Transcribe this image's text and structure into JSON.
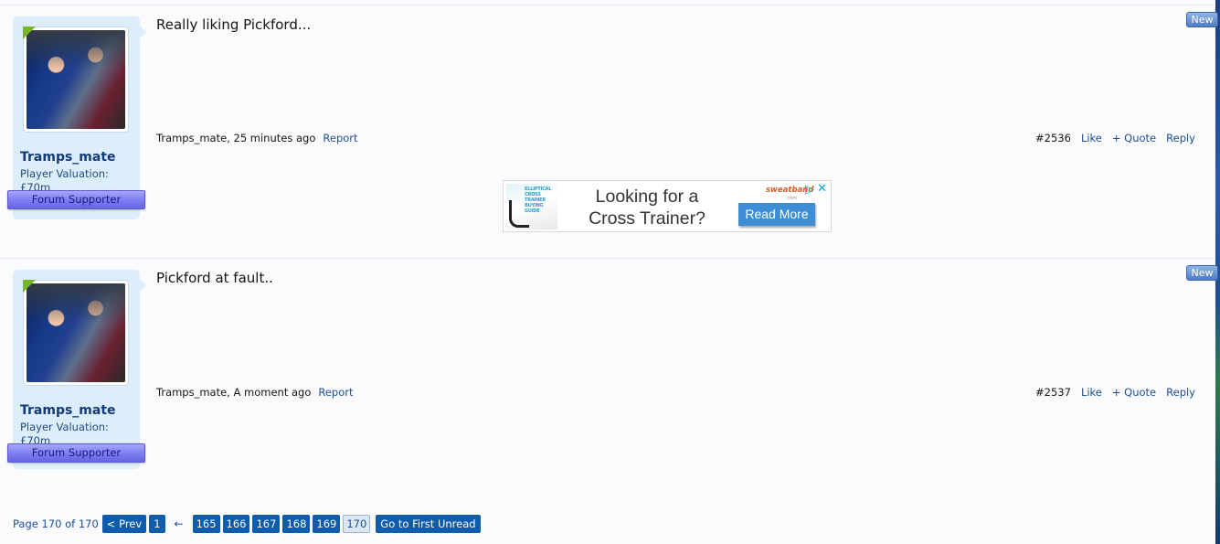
{
  "posts": [
    {
      "username": "Tramps_mate",
      "user_title": "Player Valuation: £70m",
      "supporter": "Forum Supporter",
      "message": "Really liking Pickford...",
      "author_time": "Tramps_mate, 25 minutes ago",
      "report": "Report",
      "number": "#2536",
      "like": "Like",
      "quote": "+ Quote",
      "reply": "Reply",
      "new_badge": "New"
    },
    {
      "username": "Tramps_mate",
      "user_title": "Player Valuation: £70m",
      "supporter": "Forum Supporter",
      "message": "Pickford at fault..",
      "author_time": "Tramps_mate, A moment ago",
      "report": "Report",
      "number": "#2537",
      "like": "Like",
      "quote": "+ Quote",
      "reply": "Reply",
      "new_badge": "New"
    }
  ],
  "ad": {
    "image_text": "ELLIPTICAL CROSS TRAINER BUYING GUIDE",
    "headline_line1": "Looking for a",
    "headline_line2": "Cross Trainer?",
    "brand": "sweatband",
    "brand_sub": ".com",
    "choices_icon": "ad-choices-icon",
    "close_icon": "close-icon",
    "button": "Read More"
  },
  "pagination": {
    "label": "Page 170 of 170",
    "prev": "< Prev",
    "first": "1",
    "skip_icon": "←",
    "pages": [
      "165",
      "166",
      "167",
      "168",
      "169"
    ],
    "current": "170",
    "first_unread": "Go to First Unread"
  },
  "colors": {
    "link": "#1b4f95",
    "button": "#0f5cad",
    "user_card": "#dceefb",
    "supporter": "#7c7cf2"
  }
}
